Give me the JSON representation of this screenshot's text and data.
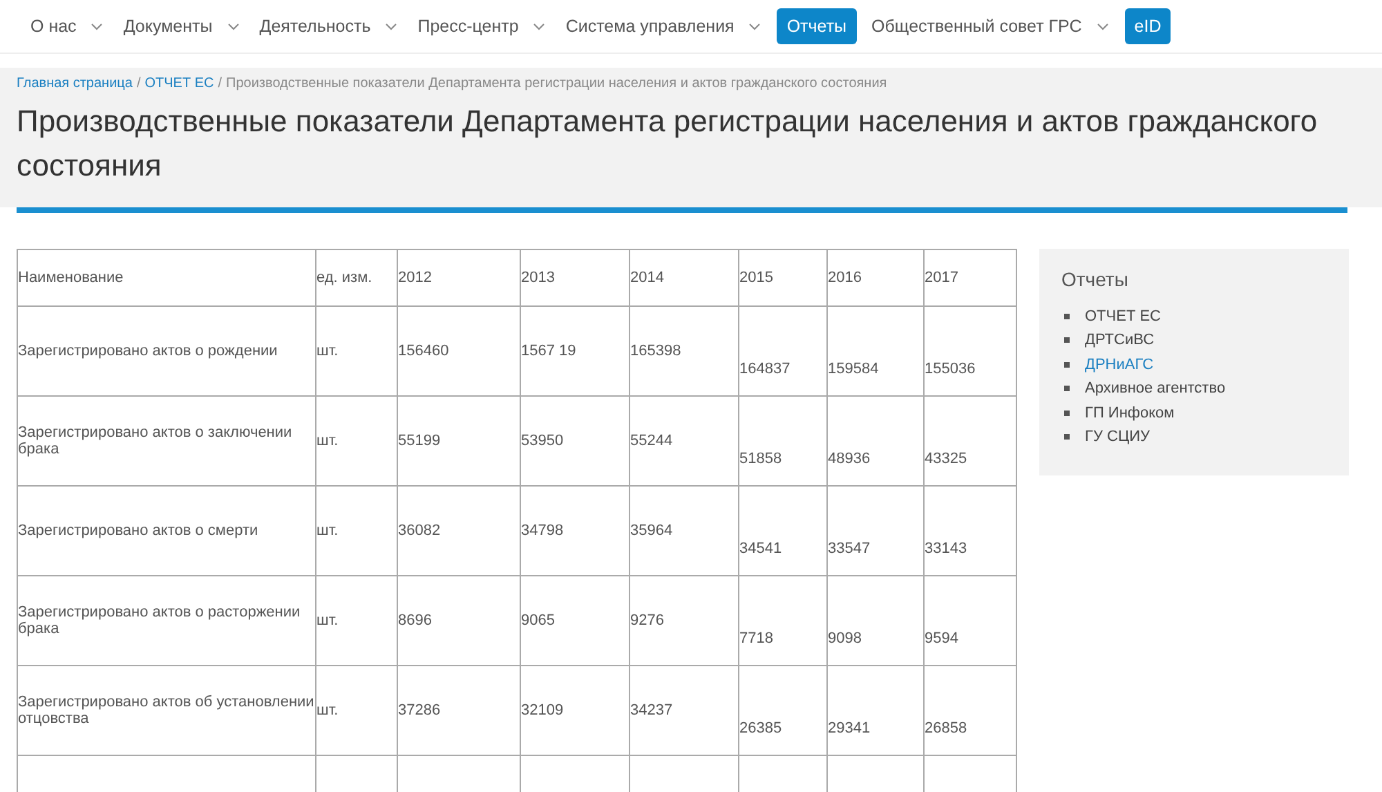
{
  "nav": [
    {
      "label": "О нас",
      "dropdown": true,
      "highlighted": false
    },
    {
      "label": "Документы",
      "dropdown": true,
      "highlighted": false
    },
    {
      "label": "Деятельность",
      "dropdown": true,
      "highlighted": false
    },
    {
      "label": "Пресс-центр",
      "dropdown": true,
      "highlighted": false
    },
    {
      "label": "Система управления",
      "dropdown": true,
      "highlighted": false
    },
    {
      "label": "Отчеты",
      "dropdown": false,
      "highlighted": true
    },
    {
      "label": "Общественный совет ГРС",
      "dropdown": true,
      "highlighted": false
    },
    {
      "label": "eID",
      "dropdown": false,
      "highlighted": true
    }
  ],
  "breadcrumbs": [
    {
      "label": "Главная страница",
      "link": true
    },
    {
      "separator": "/",
      "label": "ОТЧЕТ ЕС",
      "link": true
    },
    {
      "separator": "/",
      "label": "Производственные показатели Департамента регистрации населения и актов гражданского состояния",
      "link": false
    }
  ],
  "page_title": "Производственные показатели Департамента регистрации населения и актов гражданского состояния",
  "table": {
    "columns": [
      "Наименование",
      "ед. изм.",
      "2012",
      "2013",
      "2014",
      "2015",
      "2016",
      "2017"
    ],
    "rows": [
      [
        "Зарегистрировано актов о рождении",
        "шт.",
        "156460",
        "1567 19",
        "165398",
        "164837",
        "159584",
        "155036"
      ],
      [
        "Зарегистрировано актов о заключении брака",
        "шт.",
        "55199",
        "53950",
        "55244",
        "51858",
        "48936",
        "43325"
      ],
      [
        "Зарегистрировано актов о смерти",
        "шт.",
        "36082",
        "34798",
        "35964",
        "34541",
        "33547",
        "33143"
      ],
      [
        "Зарегистрировано актов о расторжении брака",
        "шт.",
        "8696",
        "9065",
        "9276",
        "7718",
        "9098",
        "9594"
      ],
      [
        "Зарегистрировано актов об установлении отцовства",
        "шт.",
        "37286",
        "32109",
        "34237",
        "26385",
        "29341",
        "26858"
      ]
    ]
  },
  "sidebar": {
    "title": "Отчеты",
    "items": [
      {
        "label": "ОТЧЕТ ЕС",
        "selected": false
      },
      {
        "label": "ДРТСиВС",
        "selected": false
      },
      {
        "label": "ДРНиАГС",
        "selected": true
      },
      {
        "label": "Архивное агентство",
        "selected": false
      },
      {
        "label": "ГП Инфоком",
        "selected": false
      },
      {
        "label": "ГУ СЦИУ",
        "selected": false
      }
    ]
  }
}
